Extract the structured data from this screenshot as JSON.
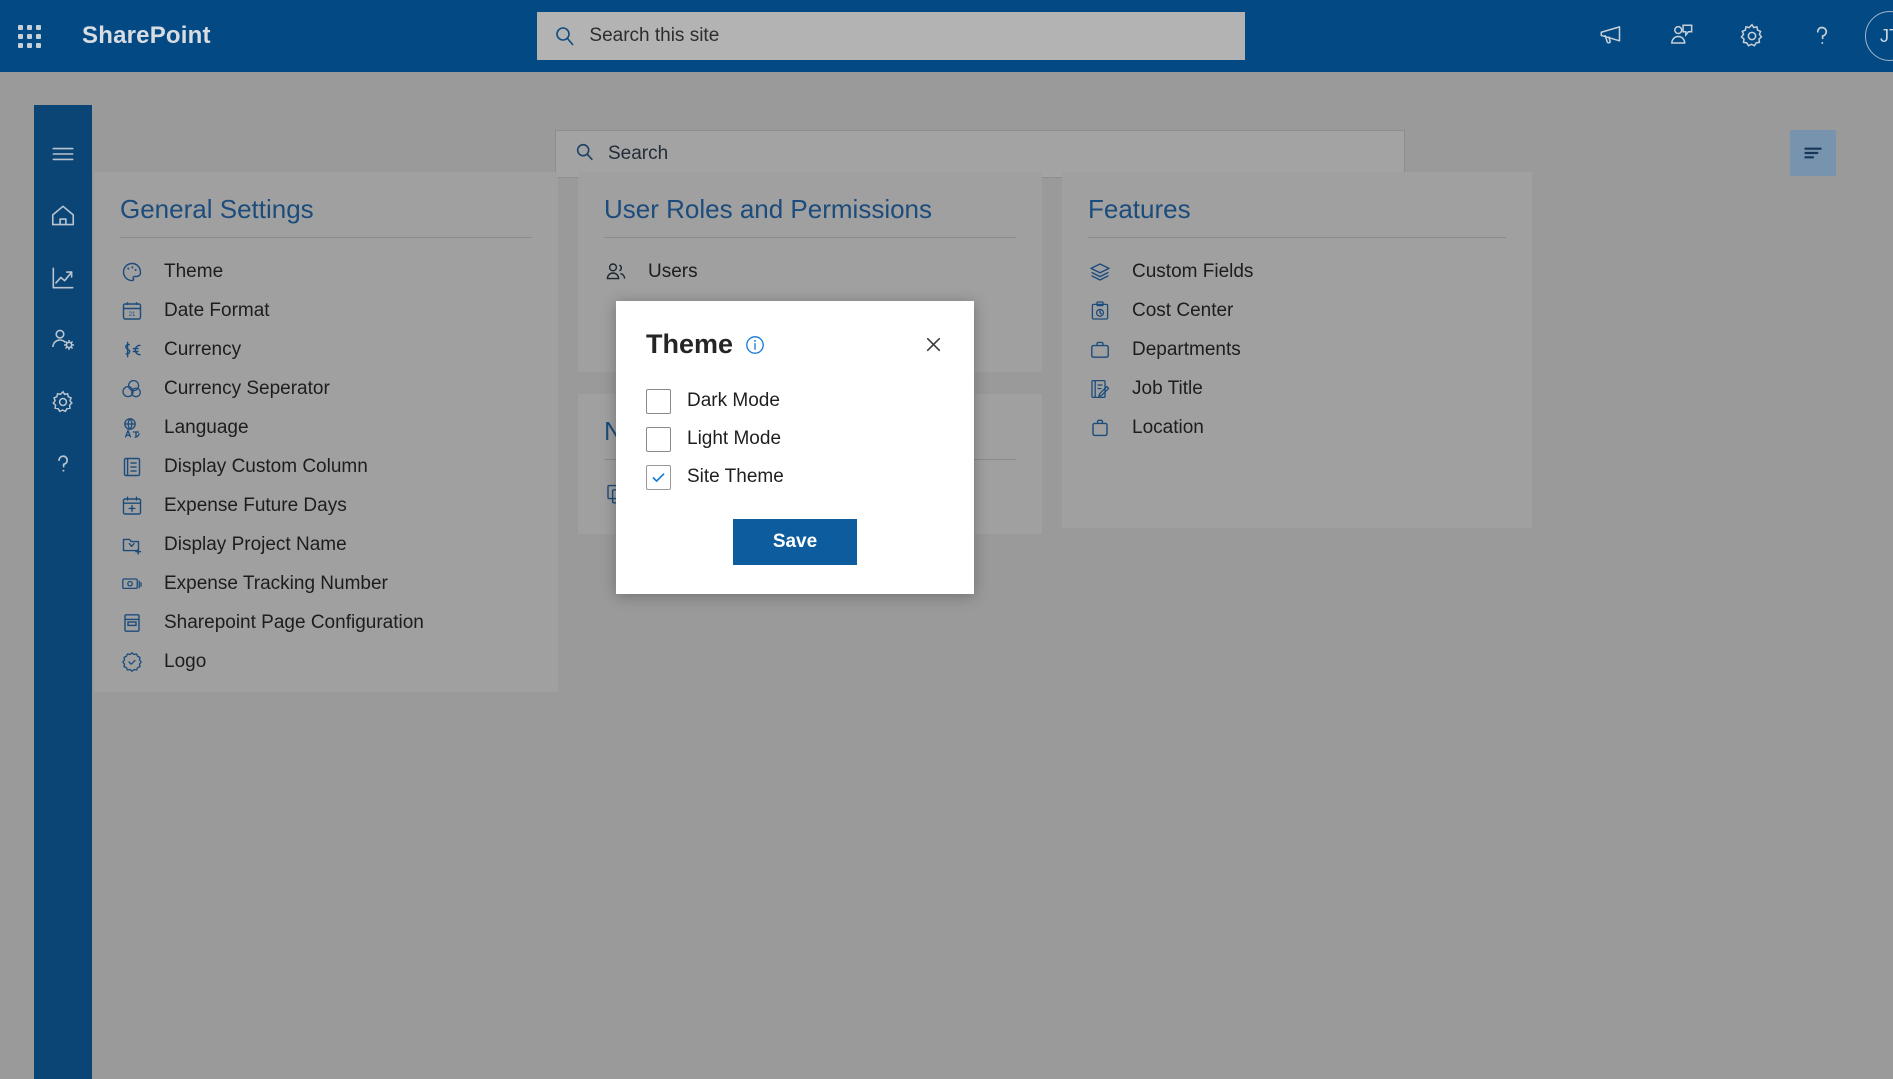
{
  "suite": {
    "brand": "SharePoint",
    "waffle_icon": "app-launcher-icon",
    "search": {
      "placeholder": "Search this site",
      "value": "",
      "icon": "search-icon"
    },
    "actions": [
      {
        "name": "megaphone-icon",
        "label": "Announcements"
      },
      {
        "name": "feedback-icon",
        "label": "Feedback"
      },
      {
        "name": "gear-icon",
        "label": "Settings"
      },
      {
        "name": "help-icon",
        "label": "Help"
      }
    ],
    "avatar": {
      "initials": "JT"
    }
  },
  "rail": {
    "items": [
      {
        "icon": "hamburger-icon",
        "label": "Menu"
      },
      {
        "icon": "home-icon",
        "label": "Home"
      },
      {
        "icon": "analytics-icon",
        "label": "Reports"
      },
      {
        "icon": "user-settings-icon",
        "label": "User Settings"
      },
      {
        "icon": "gear-icon",
        "label": "Settings"
      },
      {
        "icon": "help-icon",
        "label": "Help"
      }
    ]
  },
  "content": {
    "search": {
      "placeholder": "Search",
      "value": "",
      "icon": "search-icon"
    },
    "filter_button": {
      "icon": "filter-icon",
      "label": "Filter"
    }
  },
  "cards": {
    "general": {
      "title": "General Settings",
      "items": [
        {
          "icon": "palette-icon",
          "label": "Theme"
        },
        {
          "icon": "calendar-icon",
          "label": "Date Format"
        },
        {
          "icon": "currency-icon",
          "label": "Currency"
        },
        {
          "icon": "coins-icon",
          "label": "Currency Seperator"
        },
        {
          "icon": "language-icon",
          "label": "Language"
        },
        {
          "icon": "list-icon",
          "label": "Display Custom Column"
        },
        {
          "icon": "calendar-add-icon",
          "label": "Expense Future Days"
        },
        {
          "icon": "folder-add-icon",
          "label": "Display Project Name"
        },
        {
          "icon": "money-icon",
          "label": "Expense Tracking Number"
        },
        {
          "icon": "page-icon",
          "label": "Sharepoint Page Configuration"
        },
        {
          "icon": "badge-icon",
          "label": "Logo"
        }
      ]
    },
    "roles": {
      "title": "User Roles and Permissions",
      "items": [
        {
          "icon": "people-icon",
          "label": "Users"
        }
      ]
    },
    "notifications": {
      "title": "N",
      "items": [
        {
          "icon": "copy-icon",
          "label": ""
        }
      ]
    },
    "features": {
      "title": "Features",
      "items": [
        {
          "icon": "layers-icon",
          "label": "Custom Fields"
        },
        {
          "icon": "cost-center-icon",
          "label": "Cost Center"
        },
        {
          "icon": "briefcase-icon",
          "label": "Departments"
        },
        {
          "icon": "job-title-icon",
          "label": "Job Title"
        },
        {
          "icon": "bag-icon",
          "label": "Location"
        }
      ]
    }
  },
  "modal": {
    "title": "Theme",
    "info_icon": "info-icon",
    "close_icon": "close-icon",
    "options": [
      {
        "label": "Dark Mode",
        "checked": false
      },
      {
        "label": "Light Mode",
        "checked": false
      },
      {
        "label": "Site Theme",
        "checked": true
      }
    ],
    "save_label": "Save"
  },
  "colors": {
    "header_blue": "#034a85",
    "rail_blue": "#0a4576",
    "accent_blue": "#0d5c9e",
    "title_blue": "#1c4c7c",
    "page_bg": "#9a9a9a",
    "card_bg": "#a0a0a0"
  }
}
